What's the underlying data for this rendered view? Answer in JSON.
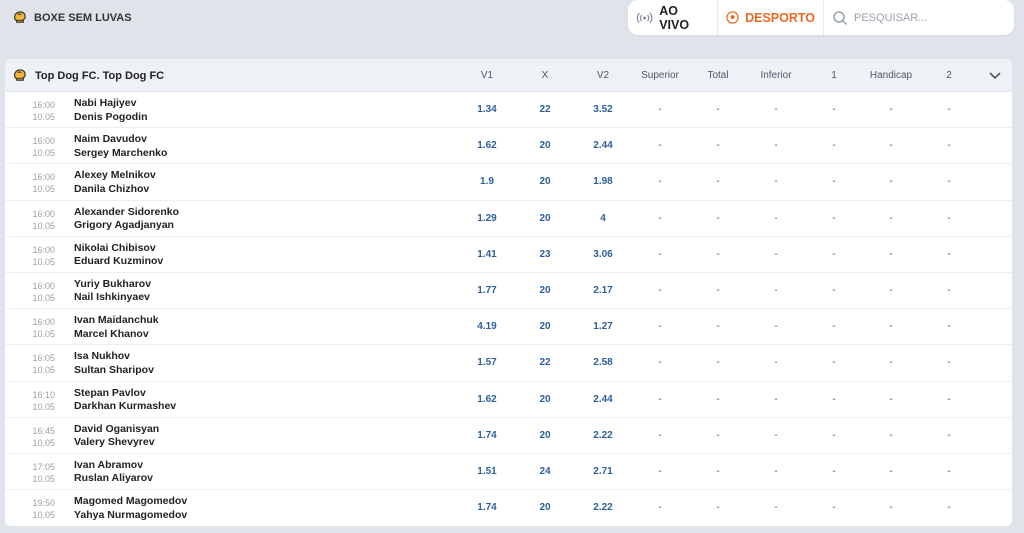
{
  "header": {
    "sport_title": "BOXE SEM LUVAS",
    "live_label": "AO VIVO",
    "sport_label": "DESPORTO",
    "search_placeholder": "PESQUISAR..."
  },
  "colors": {
    "accent": "#ea6a22",
    "odd_text": "#2b5f9a"
  },
  "table": {
    "league": "Top Dog FC. Top Dog FC",
    "columns": [
      "V1",
      "X",
      "V2",
      "Superior",
      "Total",
      "Inferior",
      "1",
      "Handicap",
      "2"
    ],
    "rows": [
      {
        "time": "16:00",
        "date": "10.05",
        "p1": "Nabi Hajiyev",
        "p2": "Denis Pogodin",
        "odds": [
          "1.34",
          "22",
          "3.52",
          "-",
          "-",
          "-",
          "-",
          "-",
          "-"
        ]
      },
      {
        "time": "16:00",
        "date": "10.05",
        "p1": "Naim Davudov",
        "p2": "Sergey Marchenko",
        "odds": [
          "1.62",
          "20",
          "2.44",
          "-",
          "-",
          "-",
          "-",
          "-",
          "-"
        ]
      },
      {
        "time": "16:00",
        "date": "10.05",
        "p1": "Alexey Melnikov",
        "p2": "Danila Chizhov",
        "odds": [
          "1.9",
          "20",
          "1.98",
          "-",
          "-",
          "-",
          "-",
          "-",
          "-"
        ]
      },
      {
        "time": "16:00",
        "date": "10.05",
        "p1": "Alexander Sidorenko",
        "p2": "Grigory Agadjanyan",
        "odds": [
          "1.29",
          "20",
          "4",
          "-",
          "-",
          "-",
          "-",
          "-",
          "-"
        ]
      },
      {
        "time": "16:00",
        "date": "10.05",
        "p1": "Nikolai Chibisov",
        "p2": "Eduard Kuzminov",
        "odds": [
          "1.41",
          "23",
          "3.06",
          "-",
          "-",
          "-",
          "-",
          "-",
          "-"
        ]
      },
      {
        "time": "16:00",
        "date": "10.05",
        "p1": "Yuriy Bukharov",
        "p2": "Nail Ishkinyaev",
        "odds": [
          "1.77",
          "20",
          "2.17",
          "-",
          "-",
          "-",
          "-",
          "-",
          "-"
        ]
      },
      {
        "time": "16:00",
        "date": "10.05",
        "p1": "Ivan Maidanchuk",
        "p2": "Marcel Khanov",
        "odds": [
          "4.19",
          "20",
          "1.27",
          "-",
          "-",
          "-",
          "-",
          "-",
          "-"
        ]
      },
      {
        "time": "16:05",
        "date": "10.05",
        "p1": "Isa Nukhov",
        "p2": "Sultan Sharipov",
        "odds": [
          "1.57",
          "22",
          "2.58",
          "-",
          "-",
          "-",
          "-",
          "-",
          "-"
        ]
      },
      {
        "time": "16:10",
        "date": "10.05",
        "p1": "Stepan Pavlov",
        "p2": "Darkhan Kurmashev",
        "odds": [
          "1.62",
          "20",
          "2.44",
          "-",
          "-",
          "-",
          "-",
          "-",
          "-"
        ]
      },
      {
        "time": "16:45",
        "date": "10.05",
        "p1": "David Oganisyan",
        "p2": "Valery Shevyrev",
        "odds": [
          "1.74",
          "20",
          "2.22",
          "-",
          "-",
          "-",
          "-",
          "-",
          "-"
        ]
      },
      {
        "time": "17:05",
        "date": "10.05",
        "p1": "Ivan Abramov",
        "p2": "Ruslan Aliyarov",
        "odds": [
          "1.51",
          "24",
          "2.71",
          "-",
          "-",
          "-",
          "-",
          "-",
          "-"
        ]
      },
      {
        "time": "19:50",
        "date": "10.05",
        "p1": "Magomed Magomedov",
        "p2": "Yahya Nurmagomedov",
        "odds": [
          "1.74",
          "20",
          "2.22",
          "-",
          "-",
          "-",
          "-",
          "-",
          "-"
        ]
      }
    ]
  }
}
